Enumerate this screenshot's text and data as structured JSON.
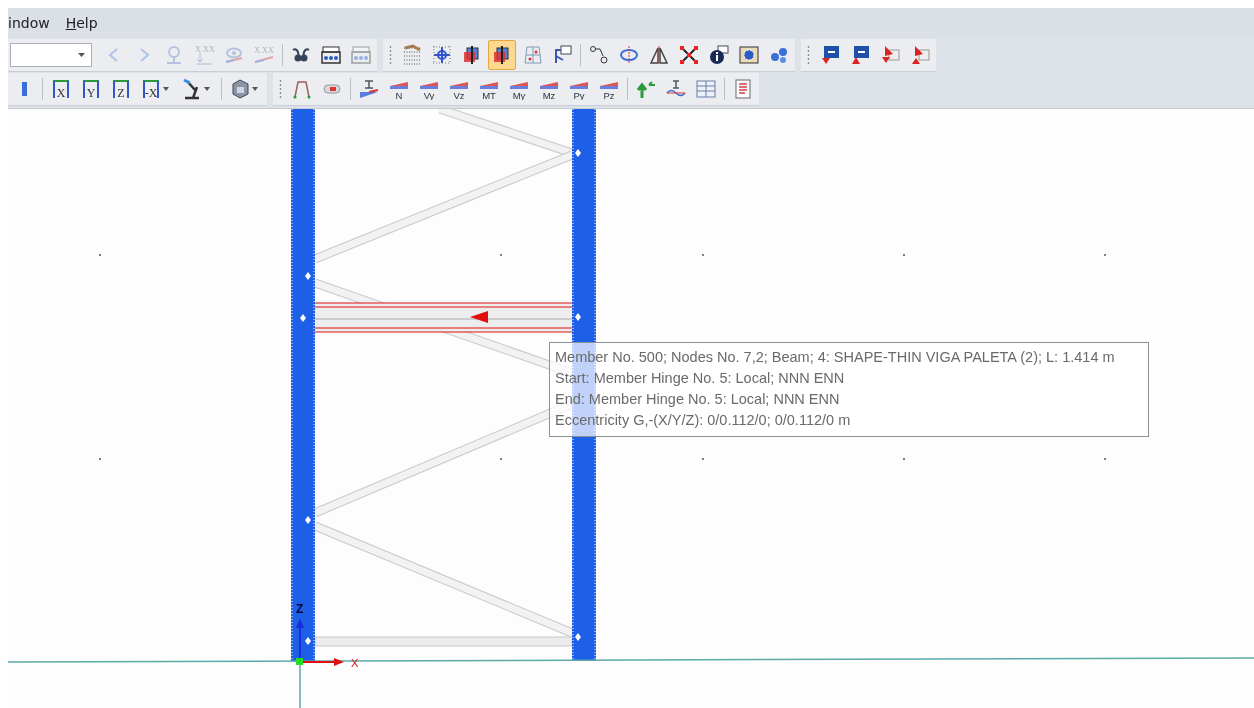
{
  "menu": [
    {
      "label": "indow",
      "mnemonic": false
    },
    {
      "label": "Help",
      "mnemonic": true
    }
  ],
  "toolbar_rows": [
    [
      {
        "grip": false,
        "groups": [
          [
            {
              "kind": "combo",
              "disabled": false,
              "selected": false
            },
            {
              "kind": "arrow-left",
              "disabled": true,
              "selected": false
            },
            {
              "kind": "arrow-right",
              "disabled": true,
              "selected": false
            },
            {
              "kind": "pin",
              "disabled": true,
              "selected": false
            },
            {
              "kind": "value-down",
              "label": "X.XX",
              "disabled": true,
              "selected": false
            },
            {
              "kind": "eye",
              "disabled": true,
              "selected": false
            },
            {
              "kind": "value-line",
              "label": "X.XX",
              "disabled": true,
              "selected": false
            }
          ],
          [
            {
              "kind": "glasses",
              "disabled": false,
              "selected": false
            },
            {
              "kind": "frame-load",
              "disabled": false,
              "selected": false
            },
            {
              "kind": "frame-load",
              "disabled": true,
              "selected": false
            }
          ]
        ]
      },
      {
        "grip": true,
        "groups": [
          [
            {
              "kind": "grid-dots",
              "disabled": false,
              "selected": false
            },
            {
              "kind": "node-grid",
              "disabled": false,
              "selected": false
            },
            {
              "kind": "cube",
              "disabled": false,
              "selected": false
            },
            {
              "kind": "cube",
              "disabled": false,
              "selected": true
            },
            {
              "kind": "grid-frame",
              "disabled": false,
              "selected": false
            },
            {
              "kind": "window-node",
              "disabled": false,
              "selected": false
            }
          ],
          [
            {
              "kind": "node-link",
              "disabled": false,
              "selected": false
            },
            {
              "kind": "rotate",
              "disabled": false,
              "selected": false
            },
            {
              "kind": "mirror",
              "disabled": false,
              "selected": false
            },
            {
              "kind": "cross",
              "disabled": false,
              "selected": false
            },
            {
              "kind": "info",
              "disabled": false,
              "selected": false
            },
            {
              "kind": "gear-window",
              "disabled": false,
              "selected": false
            },
            {
              "kind": "gears",
              "disabled": false,
              "selected": false
            }
          ]
        ]
      },
      {
        "grip": true,
        "groups": [
          [
            {
              "kind": "support-down",
              "disabled": false,
              "selected": false
            },
            {
              "kind": "support-up",
              "disabled": false,
              "selected": false
            },
            {
              "kind": "flag-down",
              "disabled": false,
              "selected": false
            },
            {
              "kind": "flag-up",
              "disabled": false,
              "selected": false
            }
          ]
        ]
      }
    ],
    [
      {
        "grip": false,
        "groups": [
          [
            {
              "kind": "edge",
              "disabled": false,
              "selected": false
            }
          ],
          [
            {
              "kind": "axis-view",
              "label": "X",
              "disabled": false,
              "selected": false
            },
            {
              "kind": "axis-view",
              "label": "Y",
              "disabled": false,
              "selected": false
            },
            {
              "kind": "axis-view",
              "label": "Z",
              "disabled": false,
              "selected": false
            },
            {
              "kind": "axis-view",
              "label": "-X",
              "dropdown": true,
              "disabled": false,
              "selected": false
            },
            {
              "kind": "microscope",
              "dropdown": true,
              "disabled": false,
              "selected": false
            }
          ],
          [
            {
              "kind": "cube-view",
              "dropdown": true,
              "disabled": false,
              "selected": false
            }
          ]
        ]
      },
      {
        "grip": true,
        "groups": [
          [
            {
              "kind": "polyline",
              "disabled": false,
              "selected": false
            },
            {
              "kind": "pill",
              "disabled": false,
              "selected": false
            }
          ],
          [
            {
              "kind": "section-beam",
              "disabled": false,
              "selected": false
            },
            {
              "kind": "force",
              "label": "N",
              "disabled": false,
              "selected": false
            },
            {
              "kind": "force",
              "label": "Vy",
              "disabled": false,
              "selected": false
            },
            {
              "kind": "force",
              "label": "Vz",
              "disabled": false,
              "selected": false
            },
            {
              "kind": "force",
              "label": "MT",
              "disabled": false,
              "selected": false
            },
            {
              "kind": "force",
              "label": "My",
              "disabled": false,
              "selected": false
            },
            {
              "kind": "force",
              "label": "Mz",
              "disabled": false,
              "selected": false
            },
            {
              "kind": "force",
              "label": "Py",
              "disabled": false,
              "selected": false
            },
            {
              "kind": "force",
              "label": "Pz",
              "disabled": false,
              "selected": false
            }
          ],
          [
            {
              "kind": "arrows-up",
              "disabled": false,
              "selected": false
            },
            {
              "kind": "section-wave",
              "disabled": false,
              "selected": false
            },
            {
              "kind": "table",
              "disabled": false,
              "selected": false
            }
          ],
          [
            {
              "kind": "report",
              "disabled": false,
              "selected": false
            }
          ]
        ]
      }
    ]
  ],
  "model": {
    "axes": [
      {
        "kind": "z",
        "label": "Z"
      },
      {
        "kind": "x",
        "label": "X"
      }
    ]
  },
  "tooltip": {
    "lines": [
      "Member No. 500; Nodes No. 7,2; Beam; 4: SHAPE-THIN VIGA PALETA (2); L: 1.414 m",
      "Start: Member Hinge No. 5: Local; NNN ENN",
      "End: Member Hinge No. 5: Local; NNN ENN",
      "Eccentricity G,-(X/Y/Z): 0/0.112/0; 0/0.112/0 m"
    ]
  }
}
